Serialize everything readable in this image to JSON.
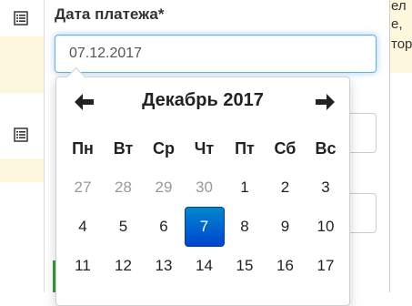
{
  "form": {
    "field_label": "Дата платежа*",
    "date_value": "07.12.2017"
  },
  "background": {
    "edge_text": [
      "ел",
      "е,",
      "тор"
    ]
  },
  "datepicker": {
    "month_year": "Декабрь 2017",
    "weekdays": [
      "Пн",
      "Вт",
      "Ср",
      "Чт",
      "Пт",
      "Сб",
      "Вс"
    ],
    "weeks": [
      [
        "27",
        "28",
        "29",
        "30",
        "1",
        "2",
        "3"
      ],
      [
        "4",
        "5",
        "6",
        "7",
        "8",
        "9",
        "10"
      ],
      [
        "11",
        "12",
        "13",
        "14",
        "15",
        "16",
        "17"
      ]
    ],
    "muted_days": [
      "27",
      "28",
      "29",
      "30"
    ],
    "selected_day": "7"
  },
  "colors": {
    "accent": "#0055cc",
    "focus_border": "#66afe9",
    "row_highlight": "#fdf7de"
  },
  "icons": {
    "row_icon": "list-icon",
    "prev": "arrow-left-icon",
    "next": "arrow-right-icon"
  }
}
